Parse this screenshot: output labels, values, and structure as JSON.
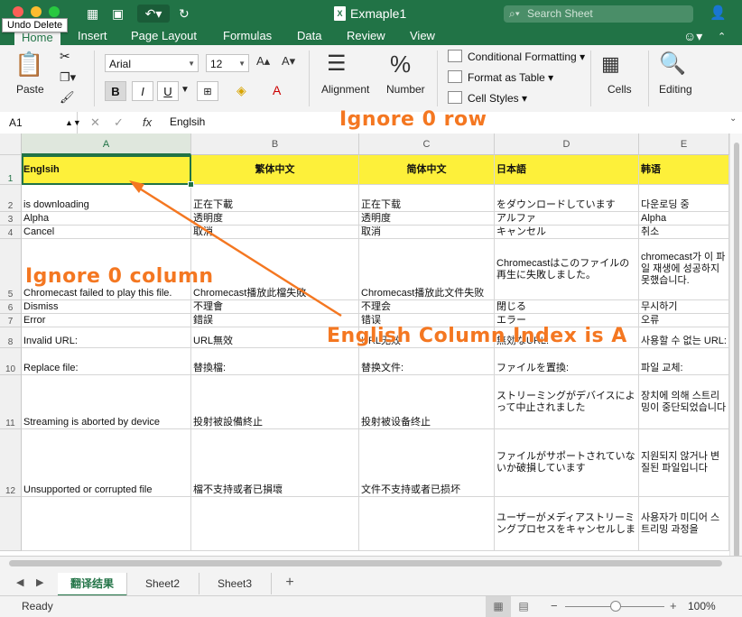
{
  "window": {
    "title": "Exmaple1",
    "file_badge": "X",
    "search_placeholder": "Search Sheet",
    "tooltip": "Undo Delete"
  },
  "ribbon_tabs": [
    "Home",
    "Insert",
    "Page Layout",
    "Formulas",
    "Data",
    "Review",
    "View"
  ],
  "ribbon": {
    "paste_label": "Paste",
    "font_name": "Arial",
    "font_size": "12",
    "bold": "B",
    "italic": "I",
    "underline": "U",
    "grow": "A",
    "shrink": "A",
    "alignment_label": "Alignment",
    "number_label": "Number",
    "conditional_formatting": "Conditional Formatting",
    "format_as_table": "Format as Table",
    "cell_styles": "Cell Styles",
    "cells_label": "Cells",
    "editing_label": "Editing",
    "percent_symbol": "%"
  },
  "formula_bar": {
    "name_box": "A1",
    "fx": "fx",
    "value": "Englsih"
  },
  "columns": [
    "A",
    "B",
    "C",
    "D",
    "E"
  ],
  "rows": [
    {
      "num": "1",
      "cells": [
        "Englsih",
        "繁体中文",
        "简体中文",
        "日本語",
        "韩语"
      ]
    },
    {
      "num": "2",
      "cells": [
        "is downloading",
        "正在下載",
        "正在下载",
        "をダウンロードしています",
        "다운로딩 중"
      ]
    },
    {
      "num": "3",
      "cells": [
        "Alpha",
        "透明度",
        "透明度",
        "アルファ",
        "Alpha"
      ]
    },
    {
      "num": "4",
      "cells": [
        "Cancel",
        "取消",
        "取消",
        "キャンセル",
        "취소"
      ]
    },
    {
      "num": "5",
      "cells": [
        "Chromecast failed to play this file.",
        "Chromecast播放此檔失敗",
        "Chromecast播放此文件失败",
        "Chromecastはこのファイルの再生に失敗しました。",
        "chromecast가 이 파일 재생에 성공하지 못했습니다."
      ]
    },
    {
      "num": "6",
      "cells": [
        "Dismiss",
        "不理會",
        "不理会",
        "閉じる",
        "무시하기"
      ]
    },
    {
      "num": "7",
      "cells": [
        "Error",
        "錯誤",
        "错误",
        "エラー",
        "오류"
      ]
    },
    {
      "num": "8",
      "cells": [
        "Invalid URL:",
        "URL無效",
        "URL无效",
        "無効なURL:",
        "사용할 수 없는 URL:"
      ]
    },
    {
      "num": "10",
      "cells": [
        "Replace file:",
        "替換檔:",
        "替换文件:",
        "ファイルを置換:",
        "파일 교체:"
      ]
    },
    {
      "num": "11",
      "cells": [
        "Streaming is aborted by device",
        "投射被設備終止",
        "投射被设备终止",
        "ストリーミングがデバイスによって中止されました",
        "장치에 의해 스트리밍이 중단되었습니다"
      ]
    },
    {
      "num": "12",
      "cells": [
        "Unsupported or corrupted file",
        "檔不支持或者已損壞",
        "文件不支持或者已损坏",
        "ファイルがサポートされていないか破損しています",
        "지원되지 않거나 변질된 파일입니다"
      ]
    },
    {
      "num": "",
      "cells": [
        "",
        "",
        "",
        "ユーザーがメディアストリーミングプロセスをキャンセルしま",
        "사용자가 미디어 스트리밍 과정을"
      ]
    }
  ],
  "sheet_tabs": [
    "翻译结果",
    "Sheet2",
    "Sheet3"
  ],
  "add_sheet": "+",
  "status": {
    "text": "Ready",
    "zoom": "100%",
    "zoom_minus": "−",
    "zoom_plus": "+"
  },
  "annotations": {
    "ignore_row": "Ignore 0 row",
    "ignore_column": "Ignore 0 column",
    "english_col": "English Column Index is A",
    "color": "#f47721"
  },
  "colors": {
    "excel_green": "#217346",
    "header_yellow": "#fdf03a"
  }
}
